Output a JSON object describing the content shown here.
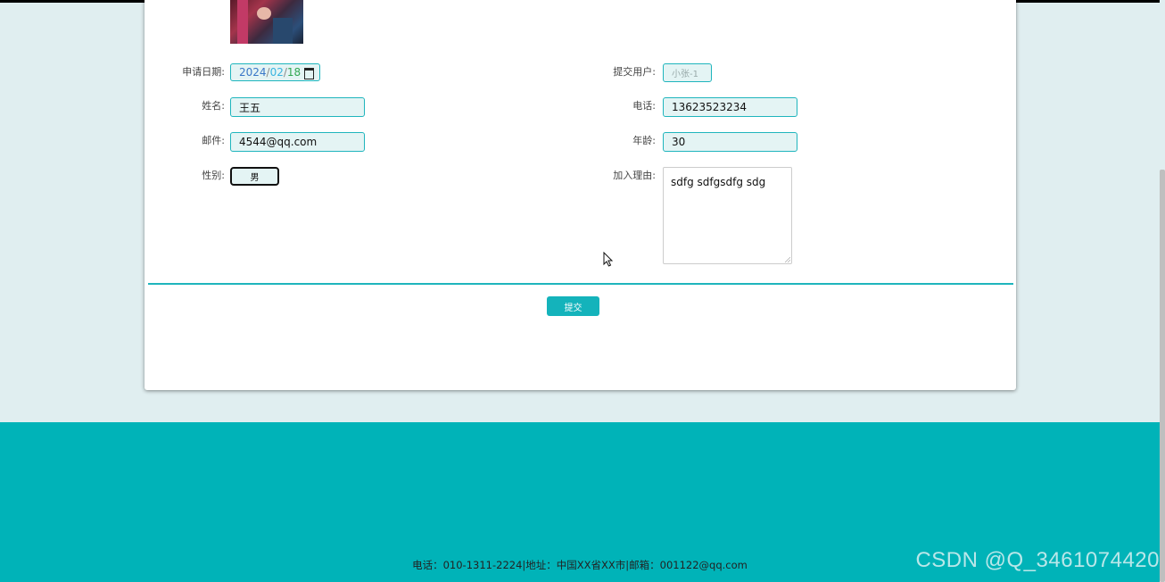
{
  "form": {
    "apply_date": {
      "label": "申请日期:",
      "year": "2024",
      "month": "02",
      "day": "18",
      "sep": "/"
    },
    "submit_user": {
      "label": "提交用户:",
      "value": "小张-1"
    },
    "name": {
      "label": "姓名:",
      "value": "王五"
    },
    "phone": {
      "label": "电话:",
      "value": "13623523234"
    },
    "email": {
      "label": "邮件:",
      "value": "4544@qq.com"
    },
    "age": {
      "label": "年龄:",
      "value": "30"
    },
    "gender": {
      "label": "性别:",
      "value": "男"
    },
    "reason": {
      "label": "加入理由:",
      "value": "sdfg sdfgsdfg sdg"
    },
    "submit_label": "提交"
  },
  "footer": {
    "text": "电话：010-1311-2224|地址：中国XX省XX市|邮箱：001122@qq.com",
    "watermark": "CSDN @Q_3461074420"
  },
  "colors": {
    "accent": "#00b3b8",
    "field_bg": "#e4f4f4",
    "page_bg": "#e0eef0"
  }
}
